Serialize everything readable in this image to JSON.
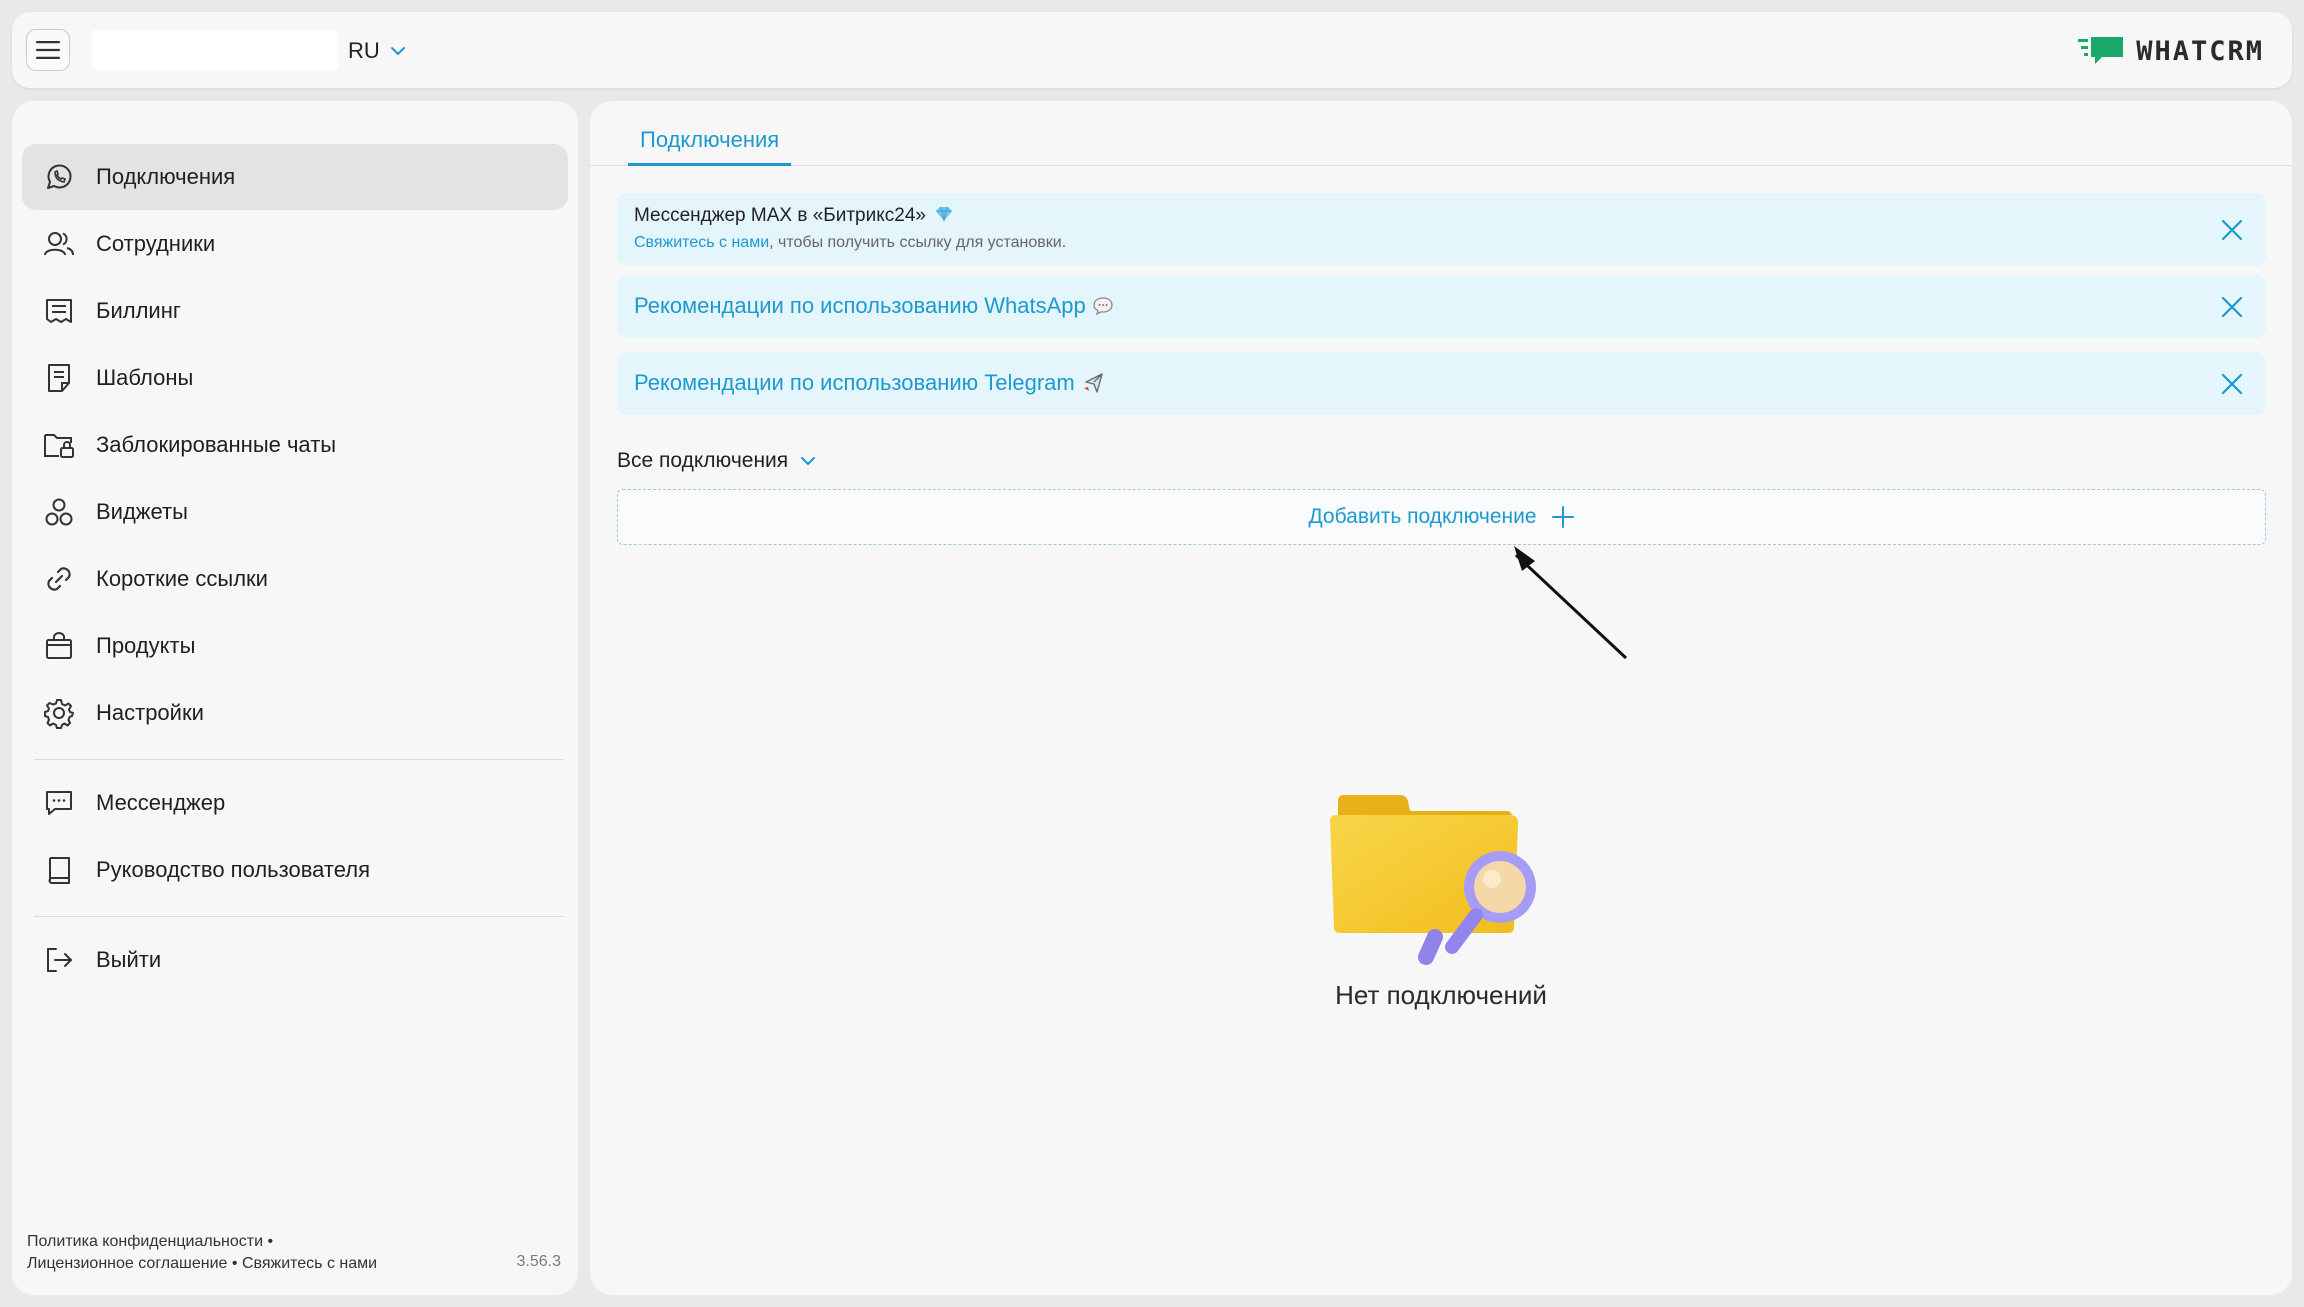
{
  "header": {
    "language": "RU",
    "logo_text": "WHATCRM",
    "brand_color": "#1aa96b"
  },
  "sidebar": {
    "items": [
      {
        "label": "Подключения",
        "icon": "whatsapp-icon",
        "active": true
      },
      {
        "label": "Сотрудники",
        "icon": "users-icon"
      },
      {
        "label": "Биллинг",
        "icon": "billing-icon"
      },
      {
        "label": "Шаблоны",
        "icon": "templates-icon"
      },
      {
        "label": "Заблокированные чаты",
        "icon": "locked-folder-icon"
      },
      {
        "label": "Виджеты",
        "icon": "widgets-icon"
      },
      {
        "label": "Короткие ссылки",
        "icon": "link-icon"
      },
      {
        "label": "Продукты",
        "icon": "bag-icon"
      },
      {
        "label": "Настройки",
        "icon": "gear-icon"
      }
    ],
    "secondary_items": [
      {
        "label": "Мессенджер",
        "icon": "chat-icon"
      },
      {
        "label": "Руководство пользователя",
        "icon": "book-icon"
      }
    ],
    "logout": {
      "label": "Выйти",
      "icon": "logout-icon"
    },
    "footer": {
      "privacy": "Политика конфиденциальности",
      "license": "Лицензионное соглашение",
      "contact": "Свяжитесь с нами",
      "version": "3.56.3"
    }
  },
  "main": {
    "tab": "Подключения",
    "notices": {
      "max": {
        "title": "Мессенджер MAX в «Битрикс24»",
        "link": "Свяжитесь с нами",
        "rest": ", чтобы получить ссылку для установки."
      },
      "whatsapp": "Рекомендации по использованию WhatsApp",
      "telegram": "Рекомендации по использованию Telegram"
    },
    "filter_label": "Все подключения",
    "add_button": "Добавить подключение",
    "empty_text": "Нет подключений"
  },
  "colors": {
    "accent": "#1c9ad0",
    "notice_bg": "#e4f5fb",
    "active_item_bg": "#e3e3e3",
    "panel_bg": "#f7f7f7",
    "page_bg": "#e9e9e9"
  }
}
